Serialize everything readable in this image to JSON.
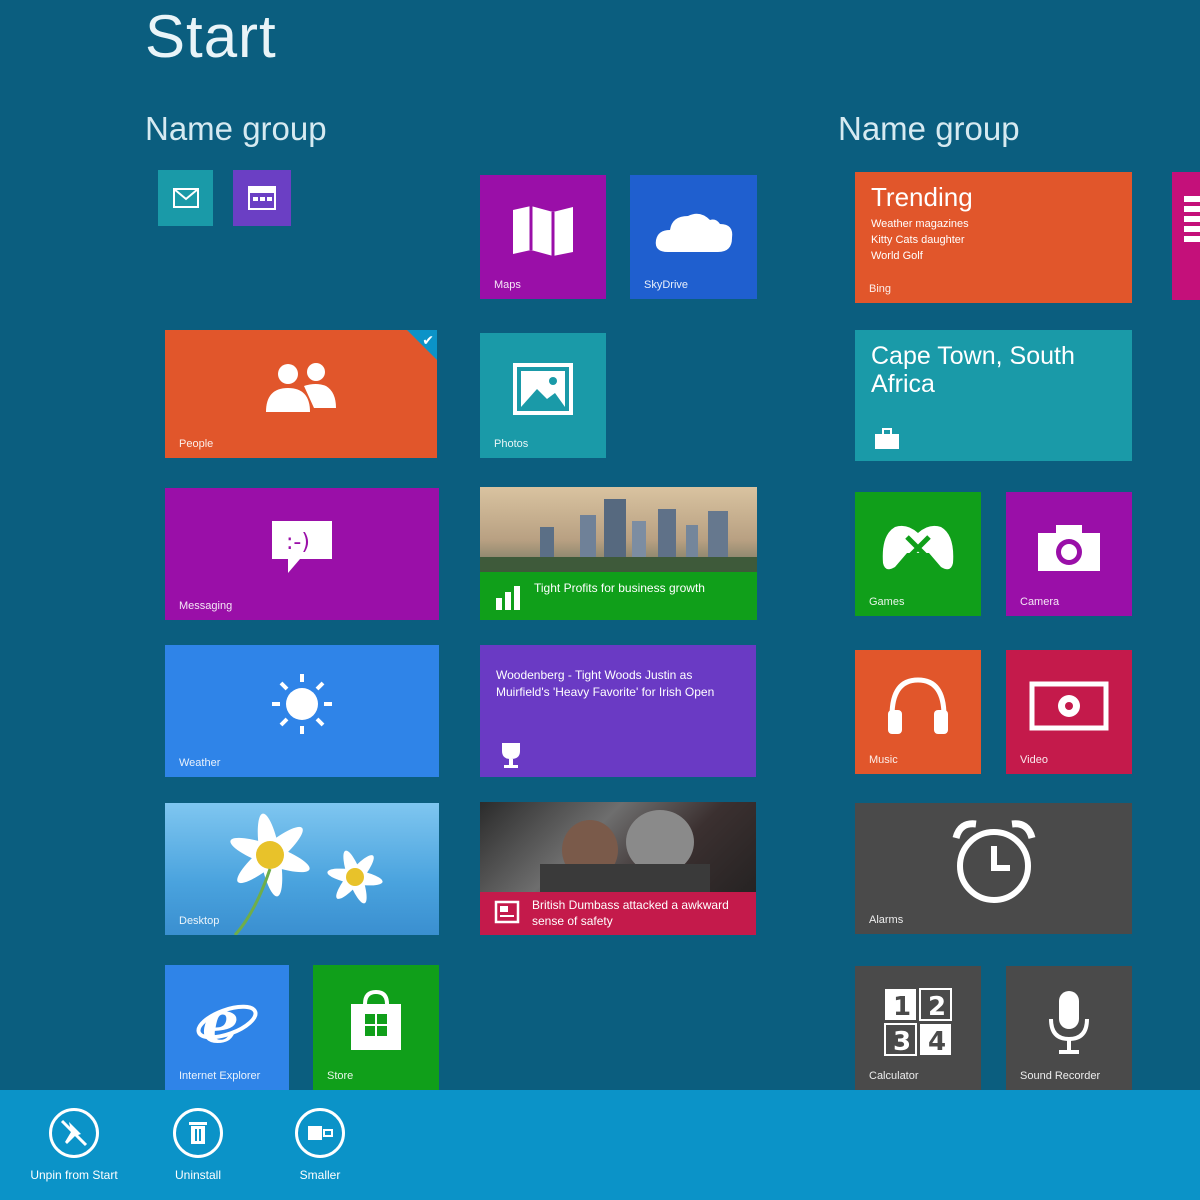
{
  "header": {
    "title": "Start"
  },
  "groups": [
    {
      "name": "Name group"
    },
    {
      "name": "Name group"
    }
  ],
  "tiles": {
    "mail_small": {
      "icon": "mail-icon",
      "color": "#1a9aa8"
    },
    "calendar_small": {
      "icon": "calendar-icon",
      "color": "#6b3fc4"
    },
    "maps": {
      "label": "Maps",
      "icon": "map-icon",
      "color": "#9a0fa8"
    },
    "skydrive": {
      "label": "SkyDrive",
      "icon": "cloud-icon",
      "color": "#1f5fcf"
    },
    "people": {
      "label": "People",
      "icon": "people-icon",
      "color": "#e1562b"
    },
    "photos": {
      "label": "Photos",
      "icon": "photo-icon",
      "color": "#1a9aa8"
    },
    "messaging": {
      "label": "Messaging",
      "icon": "chat-icon",
      "color": "#9a0fa8"
    },
    "finance": {
      "headline": "Tight Profits for business growth",
      "icon": "chart-icon",
      "color": "#109f1a"
    },
    "weather": {
      "label": "Weather",
      "icon": "sun-icon",
      "color": "#2f84e8"
    },
    "sports": {
      "headline": "Woodenberg - Tight Woods Justin as Muirfield's 'Heavy Favorite' for Irish Open",
      "icon": "trophy-icon",
      "color": "#6a3ac4"
    },
    "desktop": {
      "label": "Desktop",
      "color": "#3a8fd0"
    },
    "news": {
      "headline": "British Dumbass attacked a awkward sense of safety",
      "icon": "news-icon",
      "color": "#c41a4b"
    },
    "ie": {
      "label": "Internet Explorer",
      "icon": "ie-icon",
      "color": "#2f84e8"
    },
    "store": {
      "label": "Store",
      "icon": "store-icon",
      "color": "#109f1a"
    },
    "bing": {
      "title": "Trending",
      "lines": [
        "Weather magazines",
        "Kitty Cats daughter",
        "World Golf"
      ],
      "label": "Bing",
      "color": "#e1562b"
    },
    "travel": {
      "title": "Cape Town, South Africa",
      "icon": "suitcase-icon",
      "color": "#1a9aa8"
    },
    "games": {
      "label": "Games",
      "icon": "gamepad-icon",
      "color": "#109f1a"
    },
    "camera": {
      "label": "Camera",
      "icon": "camera-icon",
      "color": "#9a0fa8"
    },
    "music": {
      "label": "Music",
      "icon": "headphones-icon",
      "color": "#e1562b"
    },
    "video": {
      "label": "Video",
      "icon": "video-icon",
      "color": "#c41a4b"
    },
    "alarms": {
      "label": "Alarms",
      "icon": "alarm-clock-icon",
      "color": "#4a4a4a"
    },
    "calculator": {
      "label": "Calculator",
      "icon": "calculator-icon",
      "color": "#4a4a4a"
    },
    "sound_recorder": {
      "label": "Sound Recorder",
      "icon": "microphone-icon",
      "color": "#4a4a4a"
    }
  },
  "appbar": {
    "color": "#0b93c8",
    "buttons": [
      {
        "label": "Unpin from Start",
        "icon": "unpin-icon"
      },
      {
        "label": "Uninstall",
        "icon": "uninstall-icon"
      },
      {
        "label": "Smaller",
        "icon": "resize-icon"
      }
    ]
  }
}
